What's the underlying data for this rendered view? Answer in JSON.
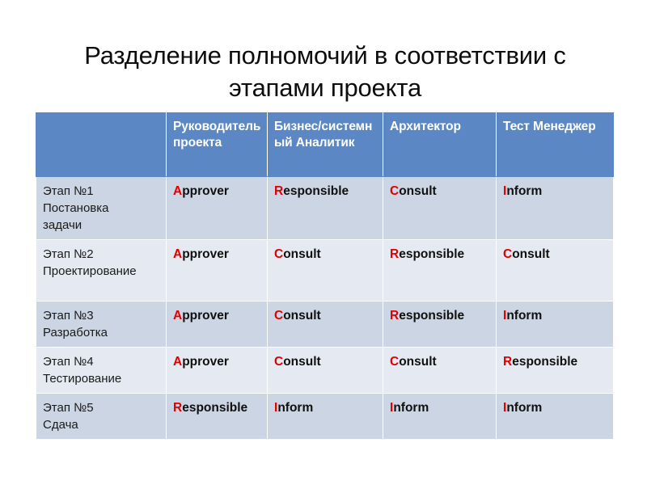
{
  "slide": {
    "title": "Разделение полномочий в соответствии с этапами проекта"
  },
  "colors": {
    "header_blue": "#5b87c4",
    "row_dark": "#ccd5e3",
    "row_light": "#e5eaf2",
    "accent_red": "#e00000",
    "text_dark": "#1a1a1a",
    "page_background": "#ffffff"
  },
  "table": {
    "headers": [
      "",
      "Руководитель проекта",
      "Бизнес/системный Аналитик",
      "Архитектор",
      "Тест Менеджер"
    ],
    "rows": [
      {
        "stage": "Этап №1 Постановка задачи",
        "stage_lines": [
          "Этап №1",
          "Постановка",
          "задачи"
        ],
        "cells": [
          {
            "initial": "A",
            "rest": "pprover"
          },
          {
            "initial": "R",
            "rest": "esponsible"
          },
          {
            "initial": "C",
            "rest": "onsult"
          },
          {
            "initial": "I",
            "rest": "nform"
          }
        ]
      },
      {
        "stage": "Этап №2 Проектирование",
        "stage_lines": [
          "Этап №2",
          "Проектирование"
        ],
        "cells": [
          {
            "initial": "A",
            "rest": "pprover"
          },
          {
            "initial": "C",
            "rest": "onsult"
          },
          {
            "initial": "R",
            "rest": "esponsible"
          },
          {
            "initial": "C",
            "rest": "onsult"
          }
        ]
      },
      {
        "stage": "Этап №3 Разработка",
        "stage_lines": [
          "Этап №3",
          "Разработка"
        ],
        "cells": [
          {
            "initial": "A",
            "rest": "pprover"
          },
          {
            "initial": "C",
            "rest": "onsult"
          },
          {
            "initial": "R",
            "rest": "esponsible"
          },
          {
            "initial": "I",
            "rest": "nform"
          }
        ]
      },
      {
        "stage": "Этап №4 Тестирование",
        "stage_lines": [
          "Этап №4",
          "Тестирование"
        ],
        "cells": [
          {
            "initial": "A",
            "rest": "pprover"
          },
          {
            "initial": "C",
            "rest": "onsult"
          },
          {
            "initial": "C",
            "rest": "onsult"
          },
          {
            "initial": "R",
            "rest": "esponsible"
          }
        ]
      },
      {
        "stage": "Этап №5 Сдача",
        "stage_lines": [
          "Этап №5",
          "Сдача"
        ],
        "cells": [
          {
            "initial": "R",
            "rest": "esponsible"
          },
          {
            "initial": "I",
            "rest": "nform"
          },
          {
            "initial": "I",
            "rest": "nform"
          },
          {
            "initial": "I",
            "rest": "nform"
          }
        ]
      }
    ]
  }
}
